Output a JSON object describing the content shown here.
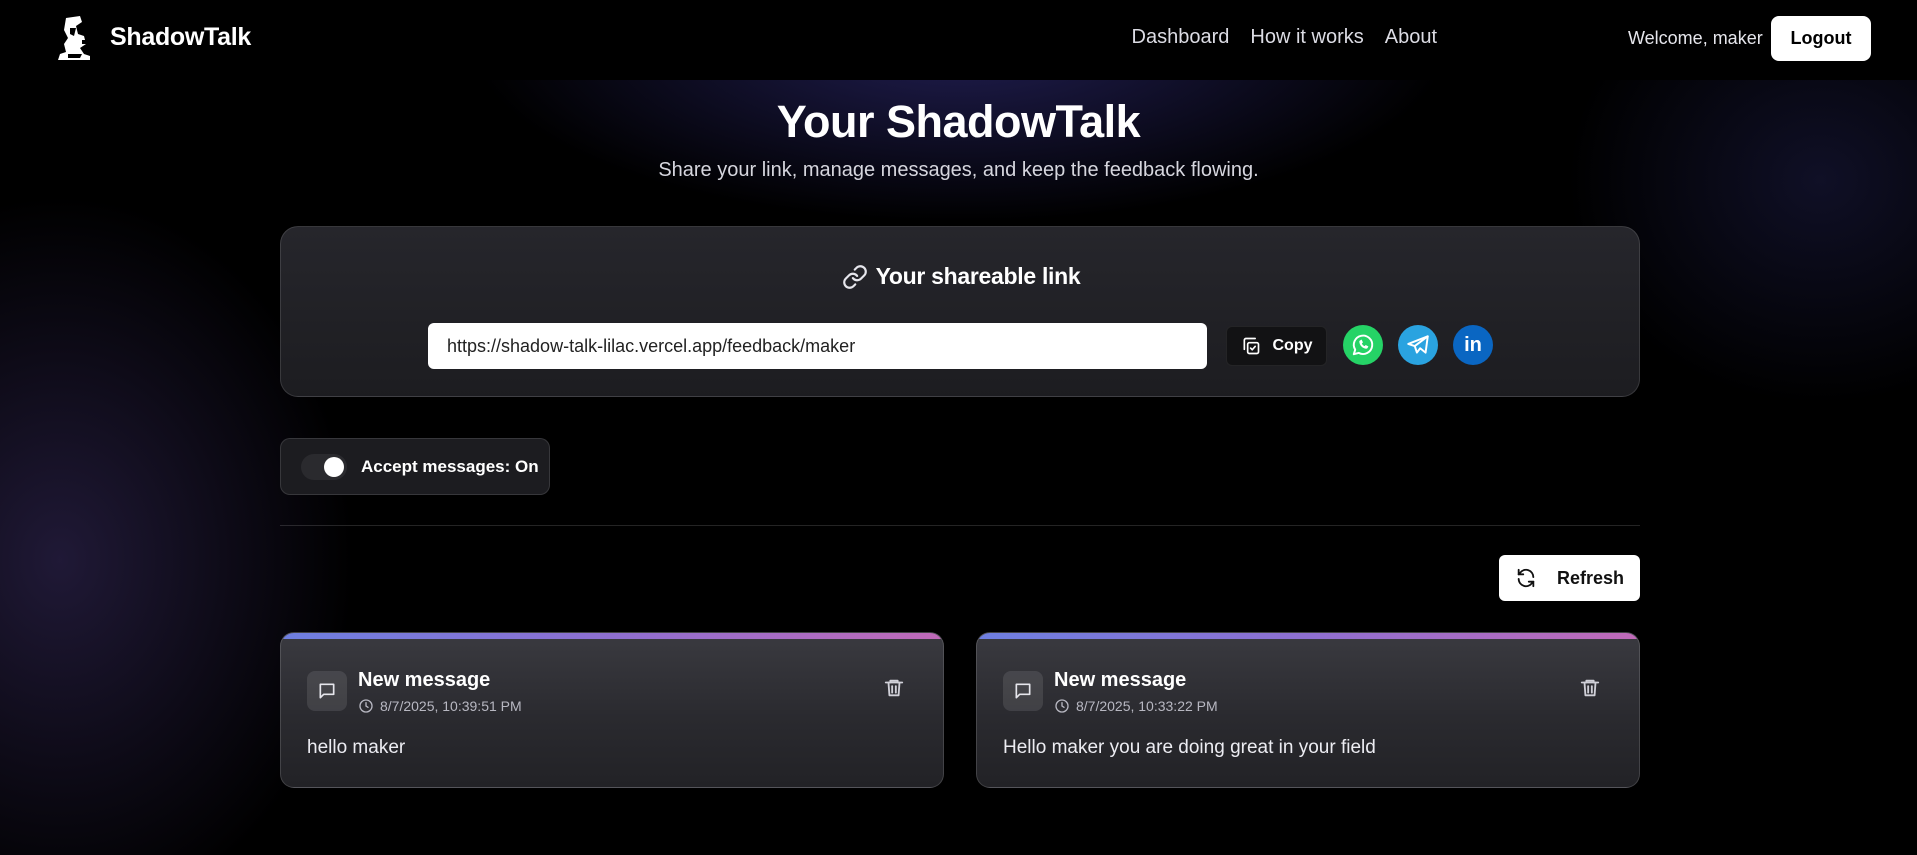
{
  "nav": {
    "brand": "ShadowTalk",
    "links": [
      "Dashboard",
      "How it works",
      "About"
    ],
    "welcome": "Welcome, maker",
    "logout_label": "Logout"
  },
  "header": {
    "title": "Your ShadowTalk",
    "subtitle": "Share your link, manage messages, and keep the feedback flowing."
  },
  "share": {
    "title": "Your shareable link",
    "url": "https://shadow-talk-lilac.vercel.app/feedback/maker",
    "copy_label": "Copy",
    "socials": [
      "whatsapp-icon",
      "telegram-icon",
      "linkedin-icon"
    ],
    "linkedin_text": "in"
  },
  "toggle": {
    "label": "Accept messages: On",
    "on": true
  },
  "refresh_label": "Refresh",
  "messages": [
    {
      "title": "New message",
      "time": "8/7/2025, 10:39:51 PM",
      "body": "hello maker"
    },
    {
      "title": "New message",
      "time": "8/7/2025, 10:33:22 PM",
      "body": "Hello maker you are doing great in your field"
    }
  ],
  "colors": {
    "accent_gradient": [
      "#6e7fe0",
      "#c06ab8"
    ],
    "whatsapp": "#25d366",
    "telegram": "#2aa3e0",
    "linkedin": "#0a66c2"
  }
}
